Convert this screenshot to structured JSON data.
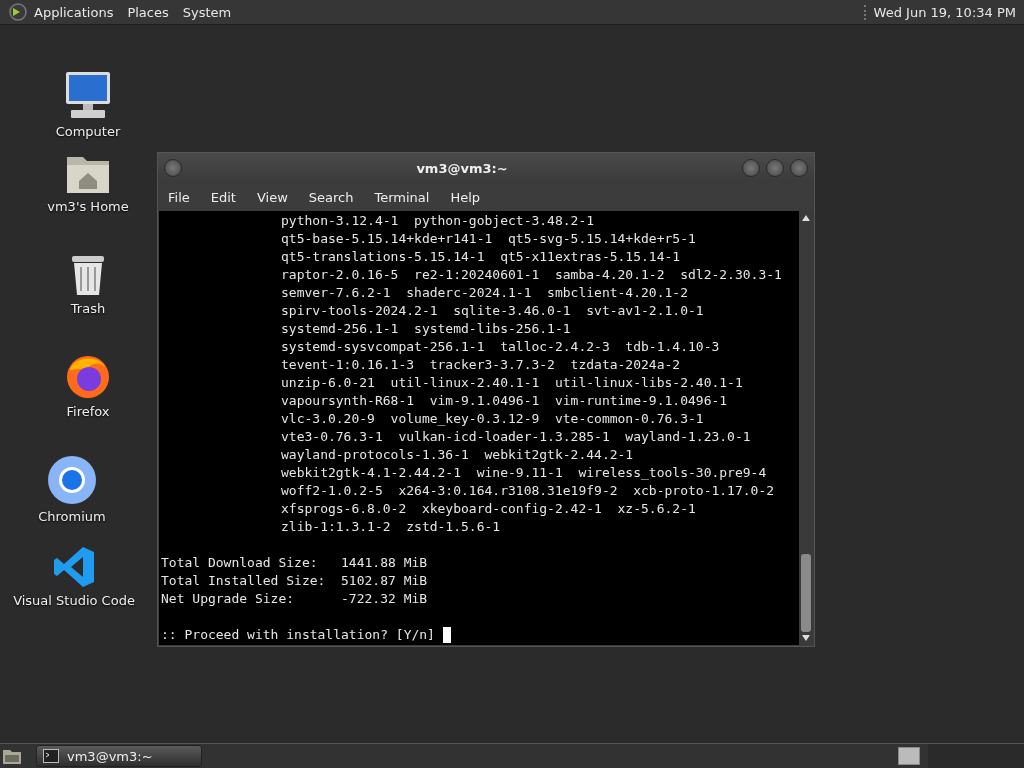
{
  "top_panel": {
    "menus": [
      "Applications",
      "Places",
      "System"
    ],
    "clock": "Wed Jun 19, 10:34 PM"
  },
  "desktop_icons": [
    {
      "kind": "computer",
      "label": "Computer"
    },
    {
      "kind": "folder",
      "label": "vm3's Home"
    },
    {
      "kind": "trash",
      "label": "Trash"
    },
    {
      "kind": "firefox",
      "label": "Firefox"
    },
    {
      "kind": "chromium",
      "label": "Chromium"
    },
    {
      "kind": "vscode",
      "label": "Visual Studio Code"
    }
  ],
  "terminal": {
    "title": "vm3@vm3:~",
    "menu": [
      "File",
      "Edit",
      "View",
      "Search",
      "Terminal",
      "Help"
    ],
    "lines": [
      {
        "kind": "package",
        "text": "python-3.12.4-1  python-gobject-3.48.2-1"
      },
      {
        "kind": "package",
        "text": "qt5-base-5.15.14+kde+r141-1  qt5-svg-5.15.14+kde+r5-1"
      },
      {
        "kind": "package",
        "text": "qt5-translations-5.15.14-1  qt5-x11extras-5.15.14-1"
      },
      {
        "kind": "package",
        "text": "raptor-2.0.16-5  re2-1:20240601-1  samba-4.20.1-2  sdl2-2.30.3-1"
      },
      {
        "kind": "package",
        "text": "semver-7.6.2-1  shaderc-2024.1-1  smbclient-4.20.1-2"
      },
      {
        "kind": "package",
        "text": "spirv-tools-2024.2-1  sqlite-3.46.0-1  svt-av1-2.1.0-1"
      },
      {
        "kind": "package",
        "text": "systemd-256.1-1  systemd-libs-256.1-1"
      },
      {
        "kind": "package",
        "text": "systemd-sysvcompat-256.1-1  talloc-2.4.2-3  tdb-1.4.10-3"
      },
      {
        "kind": "package",
        "text": "tevent-1:0.16.1-3  tracker3-3.7.3-2  tzdata-2024a-2"
      },
      {
        "kind": "package",
        "text": "unzip-6.0-21  util-linux-2.40.1-1  util-linux-libs-2.40.1-1"
      },
      {
        "kind": "package",
        "text": "vapoursynth-R68-1  vim-9.1.0496-1  vim-runtime-9.1.0496-1"
      },
      {
        "kind": "package",
        "text": "vlc-3.0.20-9  volume_key-0.3.12-9  vte-common-0.76.3-1"
      },
      {
        "kind": "package",
        "text": "vte3-0.76.3-1  vulkan-icd-loader-1.3.285-1  wayland-1.23.0-1"
      },
      {
        "kind": "package",
        "text": "wayland-protocols-1.36-1  webkit2gtk-2.44.2-1"
      },
      {
        "kind": "package",
        "text": "webkit2gtk-4.1-2.44.2-1  wine-9.11-1  wireless_tools-30.pre9-4"
      },
      {
        "kind": "package",
        "text": "woff2-1.0.2-5  x264-3:0.164.r3108.31e19f9-2  xcb-proto-1.17.0-2"
      },
      {
        "kind": "package",
        "text": "xfsprogs-6.8.0-2  xkeyboard-config-2.42-1  xz-5.6.2-1"
      },
      {
        "kind": "package",
        "text": "zlib-1:1.3.1-2  zstd-1.5.6-1"
      },
      {
        "kind": "blank"
      },
      {
        "kind": "summary",
        "text": "Total Download Size:   1441.88 MiB"
      },
      {
        "kind": "summary",
        "text": "Total Installed Size:  5102.87 MiB"
      },
      {
        "kind": "summary",
        "text": "Net Upgrade Size:      -722.32 MiB"
      },
      {
        "kind": "blank"
      },
      {
        "kind": "prompt",
        "text": ":: Proceed with installation? [Y/n] "
      }
    ]
  },
  "taskbar": {
    "tasks": [
      {
        "label": "vm3@vm3:~",
        "selected": true
      }
    ]
  }
}
